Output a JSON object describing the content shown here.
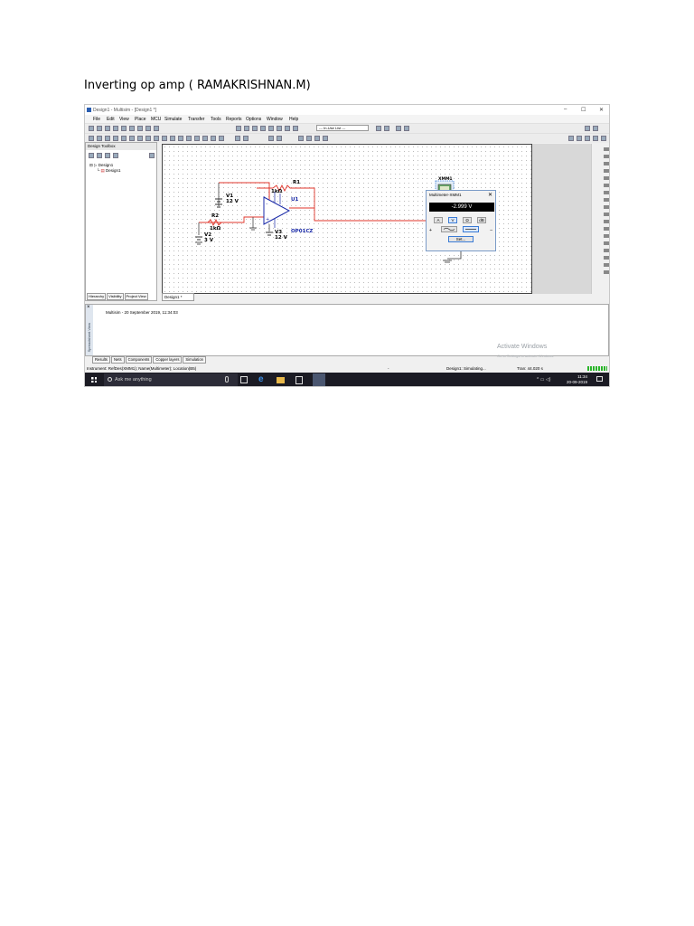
{
  "document": {
    "title": "Inverting op amp ( RAMAKRISHNAN.M)"
  },
  "window": {
    "title": "Design1 - Multisim - [Design1 *]",
    "minimize": "–",
    "maximize": "☐",
    "close": "✕",
    "menu": [
      "File",
      "Edit",
      "View",
      "Place",
      "MCU",
      "Simulate",
      "Transfer",
      "Tools",
      "Reports",
      "Options",
      "Window",
      "Help"
    ],
    "toolbar_combo": "--- In-Use List ---"
  },
  "toolbox": {
    "header": "Design Toolbox",
    "tree_root": "Design1",
    "tree_child": "Design1",
    "tabs": [
      "Hierarchy",
      "Visibility",
      "Project View"
    ]
  },
  "sheet_tab": "Design1 *",
  "schematic": {
    "v1_name": "V1",
    "v1_value": "12 V",
    "r1_name": "R1",
    "r1_value": "1kΩ",
    "u1_name": "U1",
    "u1_part": "OP01CZ",
    "r2_name": "R2",
    "r2_value": "1kΩ",
    "v2_name": "V2",
    "v2_value": "3 V",
    "v3_name": "V3",
    "v3_value": "12 V",
    "xmm_name": "XMM1"
  },
  "multimeter": {
    "title": "Multimeter-XMM1",
    "close": "✕",
    "reading": "-2.999 V",
    "modes": [
      "A",
      "V",
      "Ω",
      "dB"
    ],
    "set_label": "Set..."
  },
  "output": {
    "side_label": "Spreadsheet View",
    "message": "Multisim  -  20 September 2019, 11:34:03",
    "tabs": [
      "Results",
      "Nets",
      "Components",
      "Copper layers",
      "Simulation"
    ]
  },
  "watermark": {
    "line1": "Activate Windows",
    "line2": "Go to Settings to activate Windows."
  },
  "status": {
    "left": "Instrument: RefDes(XMM1); Name(Multimeter); Location(B5)",
    "mid": "-",
    "sim": "Design1: Simulating...",
    "tran": "Tran: 44.020 s"
  },
  "taskbar": {
    "search_placeholder": "Ask me anything",
    "time": "11:34",
    "date": "20-09-2019"
  },
  "colors": {
    "wire_red": "#e0352b",
    "part_blue": "#1a2aa8",
    "accent_blue": "#3a7bd5",
    "taskbar": "#1b1b24"
  }
}
